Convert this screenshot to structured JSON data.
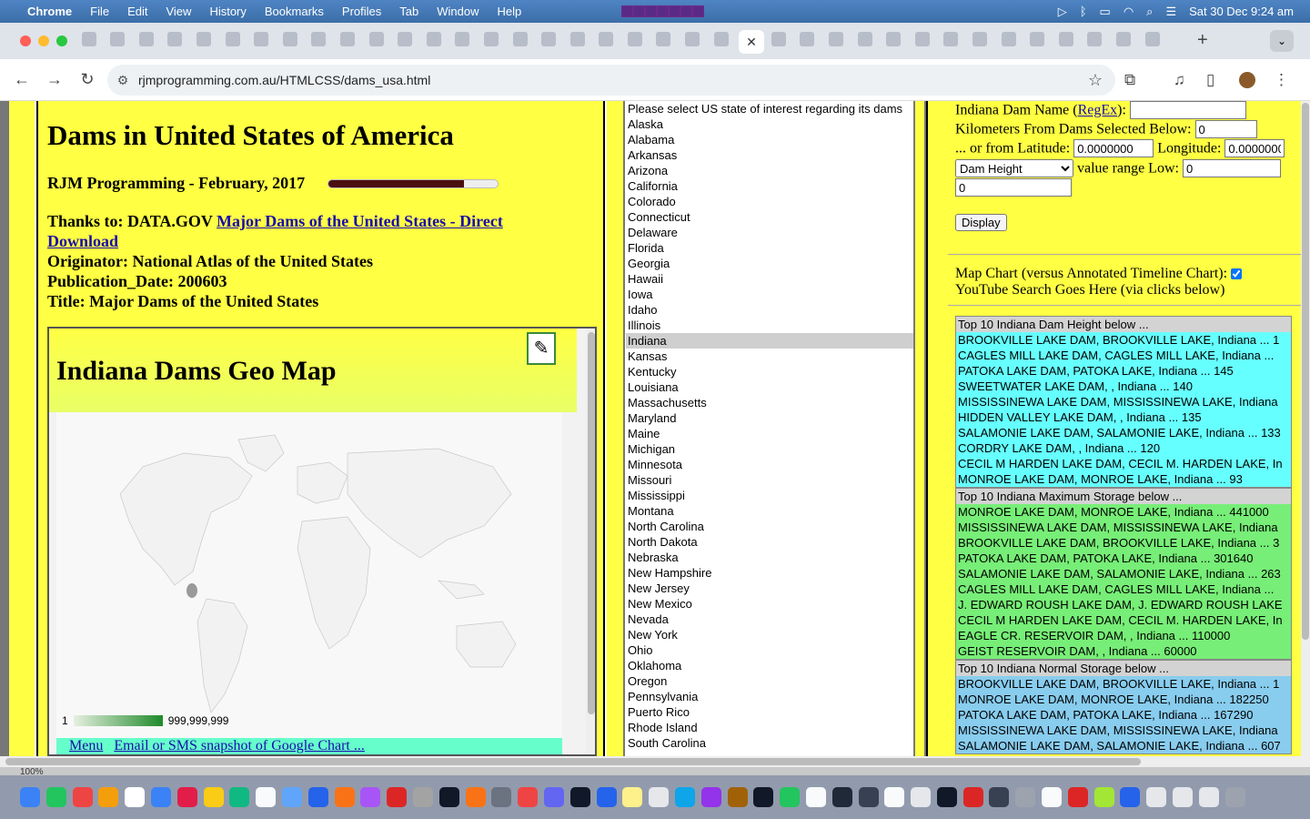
{
  "menubar": {
    "items": [
      "Chrome",
      "File",
      "Edit",
      "View",
      "History",
      "Bookmarks",
      "Profiles",
      "Tab",
      "Window",
      "Help"
    ],
    "datetime": "Sat 30 Dec  9:24 am"
  },
  "tabs": {
    "close_label": "✕",
    "new_tab_label": "+"
  },
  "address": {
    "url": "rjmprogramming.com.au/HTMLCSS/dams_usa.html"
  },
  "page": {
    "title": "Dams in United States of America",
    "subtitle": "RJM Programming - February, 2017",
    "progress_fraction": 0.8,
    "thanks_prefix": "Thanks to: DATA.GOV ",
    "thanks_link": "Major Dams of the United States - Direct Download",
    "originator": "Originator: National Atlas of the United States",
    "publication": "Publication_Date: 200603",
    "doc_title": "Title: Major Dams of the United States"
  },
  "map": {
    "title": "Indiana Dams Geo Map",
    "legend_min": "1",
    "legend_max": "999,999,999",
    "footer_menu": "Menu",
    "footer_email": "Email or SMS snapshot of Google Chart ..."
  },
  "states": {
    "prompt": "Please select US state of interest regarding its dams",
    "list": [
      "Alaska",
      "Alabama",
      "Arkansas",
      "Arizona",
      "California",
      "Colorado",
      "Connecticut",
      "Delaware",
      "Florida",
      "Georgia",
      "Hawaii",
      "Iowa",
      "Idaho",
      "Illinois",
      "Indiana",
      "Kansas",
      "Kentucky",
      "Louisiana",
      "Massachusetts",
      "Maryland",
      "Maine",
      "Michigan",
      "Minnesota",
      "Missouri",
      "Mississippi",
      "Montana",
      "North Carolina",
      "North Dakota",
      "Nebraska",
      "New Hampshire",
      "New Jersey",
      "New Mexico",
      "Nevada",
      "New York",
      "Ohio",
      "Oklahoma",
      "Oregon",
      "Pennsylvania",
      "Puerto Rico",
      "Rhode Island",
      "South Carolina"
    ],
    "selected": "Indiana"
  },
  "form": {
    "dam_name_label_prefix": "Indiana Dam Name (",
    "regex_link": "RegEx",
    "dam_name_label_suffix": "):",
    "km_label": "Kilometers From Dams Selected Below:",
    "km_value": "0",
    "lat_label": "... or from Latitude:",
    "lat_value": "0.0000000",
    "lon_label": "Longitude:",
    "lon_value": "0.0000000",
    "field_select": "Dam Height",
    "range_label": "value range Low:",
    "range_low": "0",
    "range_high": "0",
    "display_button": "Display",
    "map_chart_label": "Map Chart (versus Annotated Timeline Chart):",
    "youtube_label": "YouTube Search Goes Here (via clicks below)"
  },
  "top_height": {
    "header": "Top 10 Indiana Dam Height below ...",
    "color": "#66ffff",
    "items": [
      "BROOKVILLE LAKE DAM, BROOKVILLE LAKE, Indiana ... 1",
      "CAGLES MILL LAKE DAM, CAGLES MILL LAKE, Indiana ...",
      "PATOKA LAKE DAM, PATOKA LAKE, Indiana ... 145",
      "SWEETWATER LAKE DAM,   , Indiana ... 140",
      "MISSISSINEWA LAKE DAM, MISSISSINEWA LAKE, Indiana",
      "HIDDEN VALLEY LAKE DAM,   , Indiana ... 135",
      "SALAMONIE LAKE DAM, SALAMONIE LAKE, Indiana ... 133",
      "CORDRY LAKE DAM,   , Indiana ... 120",
      "CECIL M HARDEN LAKE DAM, CECIL M. HARDEN LAKE, In",
      "MONROE LAKE DAM, MONROE LAKE, Indiana ... 93"
    ]
  },
  "top_max_storage": {
    "header": "Top 10 Indiana Maximum Storage below ...",
    "color": "#77ee77",
    "items": [
      "MONROE LAKE DAM, MONROE LAKE, Indiana ... 441000",
      "MISSISSINEWA LAKE DAM, MISSISSINEWA LAKE, Indiana",
      "BROOKVILLE LAKE DAM, BROOKVILLE LAKE, Indiana ... 3",
      "PATOKA LAKE DAM, PATOKA LAKE, Indiana ... 301640",
      "SALAMONIE LAKE DAM, SALAMONIE LAKE, Indiana ... 263",
      "CAGLES MILL LAKE DAM, CAGLES MILL LAKE, Indiana ...",
      "J. EDWARD ROUSH LAKE DAM, J. EDWARD ROUSH LAKE",
      "CECIL M HARDEN LAKE DAM, CECIL M. HARDEN LAKE, In",
      "EAGLE CR. RESERVOIR DAM,   , Indiana ... 110000",
      "GEIST RESERVOIR DAM,   , Indiana ... 60000"
    ]
  },
  "top_normal_storage": {
    "header": "Top 10 Indiana Normal Storage below ...",
    "color": "#88ccee",
    "items": [
      "BROOKVILLE LAKE DAM, BROOKVILLE LAKE, Indiana ... 1",
      "MONROE LAKE DAM, MONROE LAKE, Indiana ... 182250",
      "PATOKA LAKE DAM, PATOKA LAKE, Indiana ... 167290",
      "MISSISSINEWA LAKE DAM, MISSISSINEWA LAKE, Indiana",
      "SALAMONIE LAKE DAM, SALAMONIE LAKE, Indiana ... 607"
    ]
  },
  "zoom": "100%"
}
